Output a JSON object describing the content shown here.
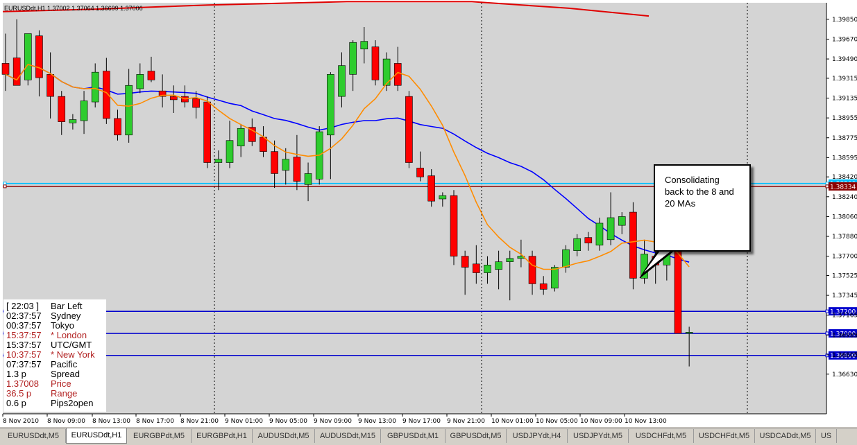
{
  "header": {
    "symbol": "EURUSDdt,H1",
    "ohlc": "1.37002 1.37064 1.36699 1.37006"
  },
  "chart_data": {
    "type": "candlestick",
    "y_range": [
      1.3627,
      1.4
    ],
    "price_ticks": [
      "1.39850",
      "1.39670",
      "1.39490",
      "1.39315",
      "1.39135",
      "1.38955",
      "1.38775",
      "1.38595",
      "1.38420",
      "1.38240",
      "1.38060",
      "1.37880",
      "1.37700",
      "1.37525",
      "1.37345",
      "1.37165",
      "1.36985",
      "1.36805",
      "1.36630"
    ],
    "time_labels": [
      "8 Nov 2010",
      "8 Nov 09:00",
      "8 Nov 13:00",
      "8 Nov 17:00",
      "8 Nov 21:00",
      "9 Nov 01:00",
      "9 Nov 05:00",
      "9 Nov 09:00",
      "9 Nov 13:00",
      "9 Nov 17:00",
      "9 Nov 21:00",
      "10 Nov 01:00",
      "10 Nov 05:00",
      "10 Nov 09:00",
      "10 Nov 13:00"
    ],
    "candles": [
      {
        "o": 1.3945,
        "h": 1.3972,
        "l": 1.392,
        "c": 1.3935
      },
      {
        "o": 1.395,
        "h": 1.3985,
        "l": 1.393,
        "c": 1.3925
      },
      {
        "o": 1.393,
        "h": 1.3972,
        "l": 1.3925,
        "c": 1.3972
      },
      {
        "o": 1.397,
        "h": 1.3975,
        "l": 1.3915,
        "c": 1.3932
      },
      {
        "o": 1.3935,
        "h": 1.3955,
        "l": 1.3895,
        "c": 1.3915
      },
      {
        "o": 1.3915,
        "h": 1.392,
        "l": 1.388,
        "c": 1.3892
      },
      {
        "o": 1.3891,
        "h": 1.3899,
        "l": 1.3885,
        "c": 1.3894
      },
      {
        "o": 1.3893,
        "h": 1.392,
        "l": 1.3881,
        "c": 1.3911
      },
      {
        "o": 1.391,
        "h": 1.3945,
        "l": 1.3905,
        "c": 1.3937
      },
      {
        "o": 1.3938,
        "h": 1.395,
        "l": 1.389,
        "c": 1.3895
      },
      {
        "o": 1.3895,
        "h": 1.3903,
        "l": 1.3875,
        "c": 1.388
      },
      {
        "o": 1.388,
        "h": 1.394,
        "l": 1.3873,
        "c": 1.3925
      },
      {
        "o": 1.3922,
        "h": 1.3945,
        "l": 1.3918,
        "c": 1.3935
      },
      {
        "o": 1.3938,
        "h": 1.3951,
        "l": 1.3928,
        "c": 1.393
      },
      {
        "o": 1.392,
        "h": 1.3935,
        "l": 1.3905,
        "c": 1.3915
      },
      {
        "o": 1.3915,
        "h": 1.3925,
        "l": 1.39,
        "c": 1.3912
      },
      {
        "o": 1.3915,
        "h": 1.3925,
        "l": 1.3905,
        "c": 1.391
      },
      {
        "o": 1.3913,
        "h": 1.392,
        "l": 1.3895,
        "c": 1.3905
      },
      {
        "o": 1.391,
        "h": 1.3915,
        "l": 1.385,
        "c": 1.3855
      },
      {
        "o": 1.3855,
        "h": 1.3866,
        "l": 1.383,
        "c": 1.3858
      },
      {
        "o": 1.3855,
        "h": 1.3893,
        "l": 1.385,
        "c": 1.3875
      },
      {
        "o": 1.387,
        "h": 1.389,
        "l": 1.386,
        "c": 1.3886
      },
      {
        "o": 1.3887,
        "h": 1.3895,
        "l": 1.387,
        "c": 1.3874
      },
      {
        "o": 1.3878,
        "h": 1.3888,
        "l": 1.386,
        "c": 1.3865
      },
      {
        "o": 1.3865,
        "h": 1.3875,
        "l": 1.3832,
        "c": 1.3845
      },
      {
        "o": 1.3848,
        "h": 1.3868,
        "l": 1.3835,
        "c": 1.3858
      },
      {
        "o": 1.386,
        "h": 1.388,
        "l": 1.383,
        "c": 1.3838
      },
      {
        "o": 1.3835,
        "h": 1.3855,
        "l": 1.382,
        "c": 1.3845
      },
      {
        "o": 1.384,
        "h": 1.3888,
        "l": 1.3835,
        "c": 1.3883
      },
      {
        "o": 1.388,
        "h": 1.3937,
        "l": 1.384,
        "c": 1.3935
      },
      {
        "o": 1.3915,
        "h": 1.3955,
        "l": 1.3905,
        "c": 1.3943
      },
      {
        "o": 1.3935,
        "h": 1.3966,
        "l": 1.392,
        "c": 1.3964
      },
      {
        "o": 1.3958,
        "h": 1.3978,
        "l": 1.3945,
        "c": 1.3965
      },
      {
        "o": 1.396,
        "h": 1.3966,
        "l": 1.3925,
        "c": 1.393
      },
      {
        "o": 1.3925,
        "h": 1.3955,
        "l": 1.392,
        "c": 1.3949
      },
      {
        "o": 1.3945,
        "h": 1.396,
        "l": 1.392,
        "c": 1.3925
      },
      {
        "o": 1.3915,
        "h": 1.392,
        "l": 1.385,
        "c": 1.3855
      },
      {
        "o": 1.385,
        "h": 1.3865,
        "l": 1.3838,
        "c": 1.3842
      },
      {
        "o": 1.3843,
        "h": 1.3849,
        "l": 1.3815,
        "c": 1.382
      },
      {
        "o": 1.3822,
        "h": 1.3828,
        "l": 1.3815,
        "c": 1.3825
      },
      {
        "o": 1.3825,
        "h": 1.383,
        "l": 1.3762,
        "c": 1.377
      },
      {
        "o": 1.377,
        "h": 1.3775,
        "l": 1.3735,
        "c": 1.376
      },
      {
        "o": 1.3763,
        "h": 1.378,
        "l": 1.3745,
        "c": 1.3755
      },
      {
        "o": 1.3755,
        "h": 1.377,
        "l": 1.3745,
        "c": 1.3762
      },
      {
        "o": 1.3758,
        "h": 1.3775,
        "l": 1.374,
        "c": 1.3765
      },
      {
        "o": 1.3765,
        "h": 1.3775,
        "l": 1.373,
        "c": 1.3768
      },
      {
        "o": 1.3768,
        "h": 1.3785,
        "l": 1.376,
        "c": 1.377
      },
      {
        "o": 1.377,
        "h": 1.3775,
        "l": 1.3735,
        "c": 1.3745
      },
      {
        "o": 1.3745,
        "h": 1.3752,
        "l": 1.3735,
        "c": 1.374
      },
      {
        "o": 1.3741,
        "h": 1.3762,
        "l": 1.3738,
        "c": 1.376
      },
      {
        "o": 1.376,
        "h": 1.378,
        "l": 1.3755,
        "c": 1.3776
      },
      {
        "o": 1.3775,
        "h": 1.379,
        "l": 1.377,
        "c": 1.3786
      },
      {
        "o": 1.3787,
        "h": 1.3792,
        "l": 1.3775,
        "c": 1.3782
      },
      {
        "o": 1.378,
        "h": 1.3805,
        "l": 1.3775,
        "c": 1.38
      },
      {
        "o": 1.3785,
        "h": 1.3828,
        "l": 1.378,
        "c": 1.3805
      },
      {
        "o": 1.3798,
        "h": 1.381,
        "l": 1.379,
        "c": 1.3806
      },
      {
        "o": 1.381,
        "h": 1.3819,
        "l": 1.374,
        "c": 1.375
      },
      {
        "o": 1.375,
        "h": 1.3785,
        "l": 1.3745,
        "c": 1.3772
      },
      {
        "o": 1.377,
        "h": 1.3782,
        "l": 1.3745,
        "c": 1.3762
      },
      {
        "o": 1.3762,
        "h": 1.379,
        "l": 1.3748,
        "c": 1.3787
      },
      {
        "o": 1.3787,
        "h": 1.3808,
        "l": 1.3702,
        "c": 1.37
      },
      {
        "o": 1.37,
        "h": 1.3706,
        "l": 1.367,
        "c": 1.3701
      }
    ],
    "horizontal_lines": [
      {
        "price": 1.3836,
        "color": "#00bfff",
        "label": "1.38360"
      },
      {
        "price": 1.38334,
        "color": "#8b0000",
        "label": "1.38334"
      },
      {
        "price": 1.372,
        "color": "#0000cd",
        "label": "1.37200"
      },
      {
        "price": 1.37,
        "color": "#0000cd",
        "label": "1.37000"
      },
      {
        "price": 1.368,
        "color": "#0000cd",
        "label": "1.36800"
      }
    ],
    "ma_colors": {
      "ma8": "#ff8c00",
      "ma20": "#0000ff",
      "ma_long": "#e00000",
      "bull": "#2ecc2e",
      "bear": "#ff0000"
    },
    "grid": "vertical-dotted"
  },
  "info_box": {
    "rows": [
      {
        "value": "[ 22:03 ]",
        "key": "Bar Left",
        "color": "#000000"
      },
      {
        "value": "02:37:57",
        "key": "Sydney",
        "color": "#000000"
      },
      {
        "value": "00:37:57",
        "key": "Tokyo",
        "color": "#000000"
      },
      {
        "value": "15:37:57",
        "key": "* London",
        "color": "#b22222"
      },
      {
        "value": "15:37:57",
        "key": "UTC/GMT",
        "color": "#000000"
      },
      {
        "value": "10:37:57",
        "key": "* New York",
        "color": "#b22222"
      },
      {
        "value": "07:37:57",
        "key": "Pacific",
        "color": "#000000"
      },
      {
        "value": "1.3 p",
        "key": "Spread",
        "color": "#000000"
      },
      {
        "value": "1.37008",
        "key": "Price",
        "color": "#b22222"
      },
      {
        "value": "36.5 p",
        "key": "Range",
        "color": "#b22222"
      },
      {
        "value": "0.6 p",
        "key": "Pips2open",
        "color": "#000000"
      }
    ]
  },
  "callout": {
    "line1": "Consolidating",
    "line2": "back to the 8 and",
    "line3": "20 MAs"
  },
  "tabs": [
    {
      "label": "EURUSDdt,M5",
      "active": false
    },
    {
      "label": "EURUSDdt,H1",
      "active": true
    },
    {
      "label": "EURGBPdt,M5",
      "active": false
    },
    {
      "label": "EURGBPdt,H1",
      "active": false
    },
    {
      "label": "AUDUSDdt,M5",
      "active": false
    },
    {
      "label": "AUDUSDdt,M15",
      "active": false
    },
    {
      "label": "GBPUSDdt,M1",
      "active": false
    },
    {
      "label": "GBPUSDdt,M5",
      "active": false
    },
    {
      "label": "USDJPYdt,H4",
      "active": false
    },
    {
      "label": "USDJPYdt,M5",
      "active": false
    },
    {
      "label": "USDCHFdt,M5",
      "active": false
    },
    {
      "label": "USDCHFdt,M5",
      "active": false
    },
    {
      "label": "USDCADdt,M5",
      "active": false
    },
    {
      "label": "US",
      "active": false
    }
  ]
}
